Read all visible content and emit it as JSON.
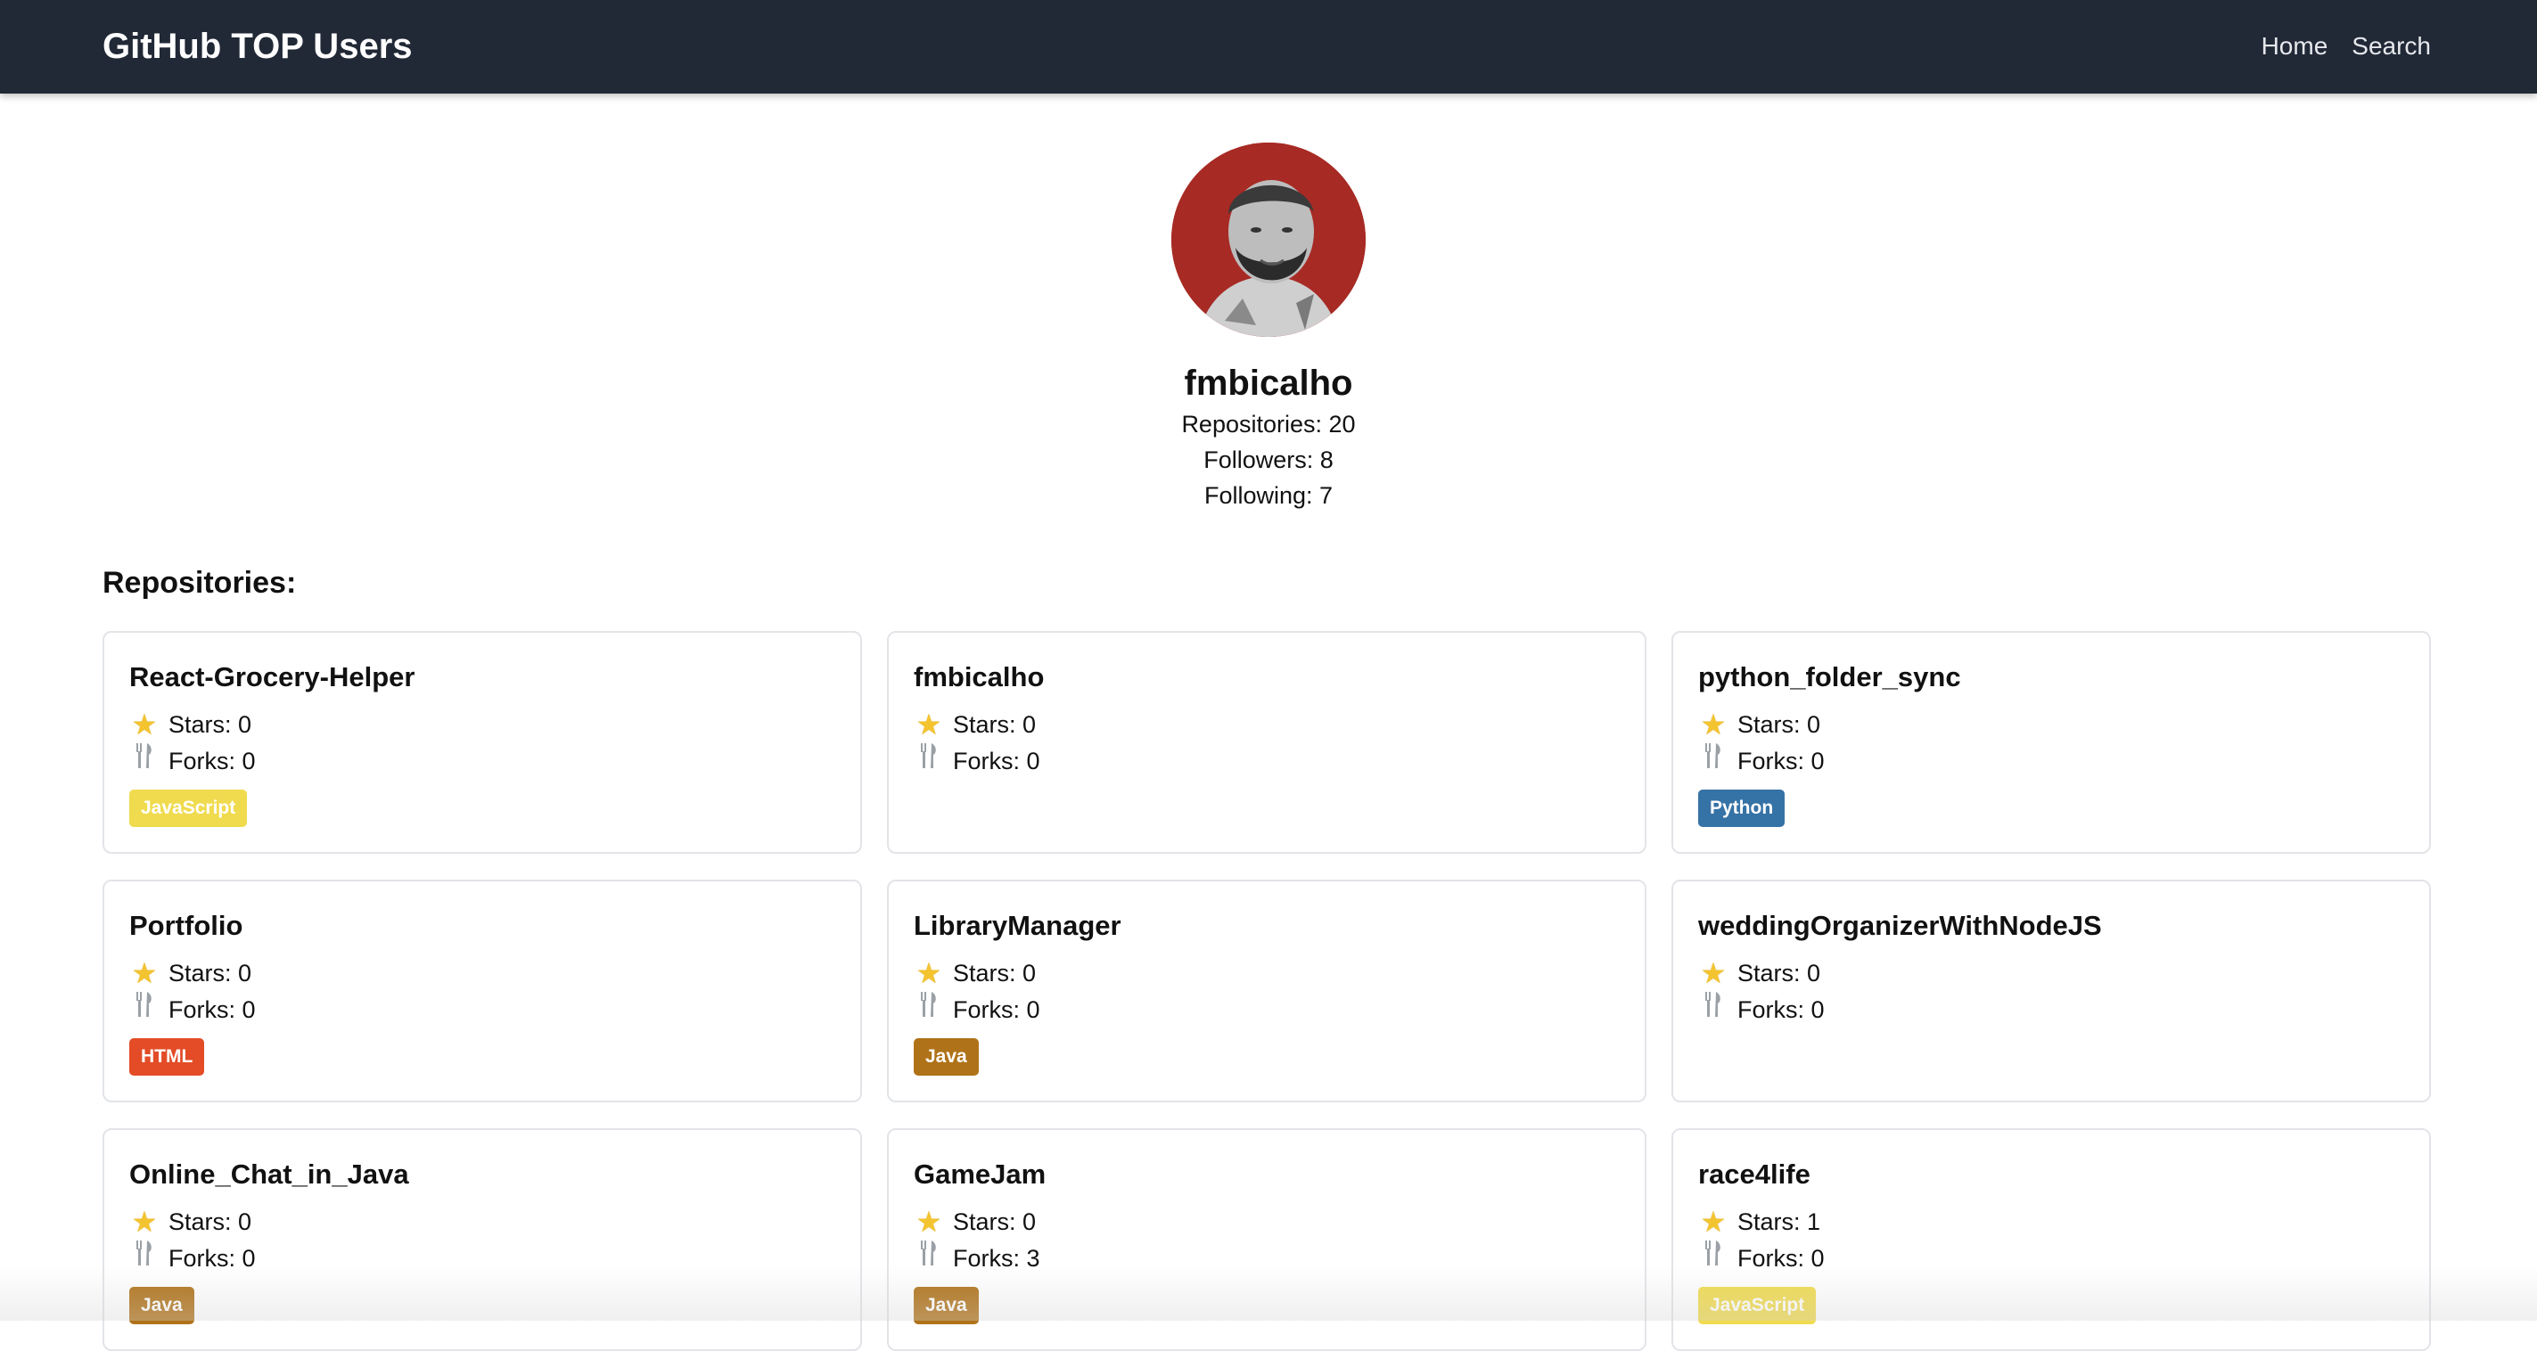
{
  "navbar": {
    "brand": "GitHub TOP Users",
    "links": [
      "Home",
      "Search"
    ]
  },
  "profile": {
    "username": "fmbicalho",
    "repositories": "Repositories: 20",
    "followers": "Followers: 8",
    "following": "Following: 7",
    "avatar_icon": "user-avatar-photo"
  },
  "section_title": "Repositories:",
  "icons": {
    "star": "star-icon",
    "fork": "fork-icon"
  },
  "colors": {
    "navbar": "#212836",
    "JavaScript": "#f0db4f",
    "Python": "#3572a5",
    "HTML": "#e34c26",
    "Java": "#b07219"
  },
  "repos": [
    {
      "name": "React-Grocery-Helper",
      "stars": "Stars: 0",
      "forks": "Forks: 0",
      "language": "JavaScript"
    },
    {
      "name": "fmbicalho",
      "stars": "Stars: 0",
      "forks": "Forks: 0",
      "language": ""
    },
    {
      "name": "python_folder_sync",
      "stars": "Stars: 0",
      "forks": "Forks: 0",
      "language": "Python"
    },
    {
      "name": "Portfolio",
      "stars": "Stars: 0",
      "forks": "Forks: 0",
      "language": "HTML"
    },
    {
      "name": "LibraryManager",
      "stars": "Stars: 0",
      "forks": "Forks: 0",
      "language": "Java"
    },
    {
      "name": "weddingOrganizerWithNodeJS",
      "stars": "Stars: 0",
      "forks": "Forks: 0",
      "language": ""
    },
    {
      "name": "Online_Chat_in_Java",
      "stars": "Stars: 0",
      "forks": "Forks: 0",
      "language": "Java"
    },
    {
      "name": "GameJam",
      "stars": "Stars: 0",
      "forks": "Forks: 3",
      "language": "Java"
    },
    {
      "name": "race4life",
      "stars": "Stars: 1",
      "forks": "Forks: 0",
      "language": "JavaScript"
    }
  ]
}
